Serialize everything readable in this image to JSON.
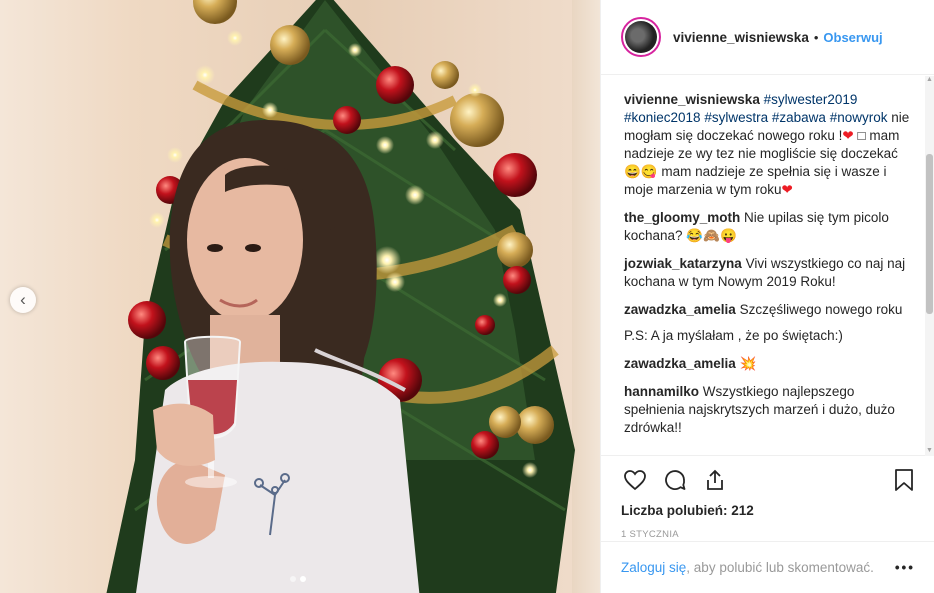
{
  "header": {
    "username": "vivienne_wisniewska",
    "separator": "•",
    "follow_label": "Obserwuj"
  },
  "caption": {
    "username": "vivienne_wisniewska",
    "tags": [
      "#sylwester2019",
      "#koniec2018",
      "#sylwestra",
      "#zabawa",
      "#nowyrok"
    ],
    "text1": "nie mogłam się doczekać nowego roku !",
    "text2": "□ mam nadzieje ze wy tez nie mogliście się doczekać",
    "emoji1": "😄😋",
    "text3": "mam nadzieje ze spełnia się i wasze i moje marzenia w tym roku"
  },
  "comments": [
    {
      "user": "the_gloomy_moth",
      "text": "Nie upilas się tym picolo kochana?",
      "emoji": "😂🙈😛"
    },
    {
      "user": "jozwiak_katarzyna",
      "text": "Vivi wszystkiego co naj naj kochana w tym Nowym 2019 Roku!",
      "emoji": ""
    },
    {
      "user": "zawadzka_amelia",
      "text": "Szczęśliwego nowego roku",
      "emoji": ""
    },
    {
      "user": "",
      "text": "P.S: A ja myślałam , że po świętach:)",
      "emoji": ""
    },
    {
      "user": "zawadzka_amelia",
      "text": "",
      "emoji": "💥"
    },
    {
      "user": "hannamilko",
      "text": "Wszystkiego najlepszego spełnienia najskrytszych marzeń i dużo, dużo zdrówka!!",
      "emoji": ""
    }
  ],
  "icons": {
    "like": "heart-outline-icon",
    "comment": "comment-bubble-icon",
    "share": "share-icon",
    "save": "bookmark-icon",
    "prev": "chevron-left-icon"
  },
  "likes_label": "Liczba polubień: 212",
  "date_label": "1 STYCZNIA",
  "login": {
    "link": "Zaloguj się",
    "text": ", aby polubić lub skomentować.",
    "more": "•••"
  },
  "carousel": {
    "total": 2,
    "active": 2
  },
  "colors": {
    "accent": "#3897f0",
    "heart": "#ed1c24",
    "border": "#efefef"
  }
}
